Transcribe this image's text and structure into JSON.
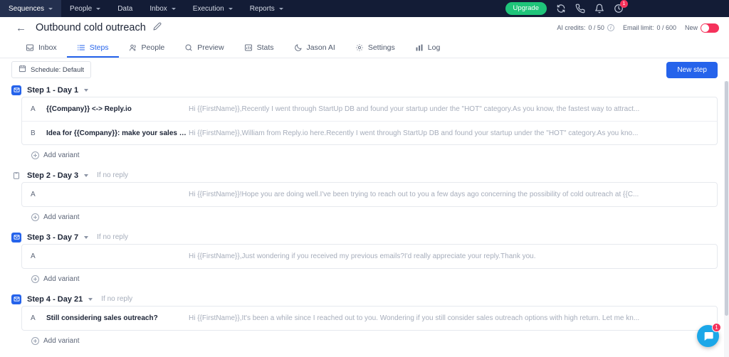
{
  "topnav": {
    "items": [
      {
        "label": "Sequences",
        "caret": true,
        "active": true
      },
      {
        "label": "People",
        "caret": true,
        "active": false
      },
      {
        "label": "Data",
        "caret": false,
        "active": false
      },
      {
        "label": "Inbox",
        "caret": true,
        "active": false
      },
      {
        "label": "Execution",
        "caret": true,
        "active": false
      },
      {
        "label": "Reports",
        "caret": true,
        "active": false
      }
    ],
    "upgrade_label": "Upgrade",
    "icons": [
      {
        "name": "sync-icon",
        "badge": null
      },
      {
        "name": "phone-icon",
        "badge": null
      },
      {
        "name": "bell-icon",
        "badge": null
      },
      {
        "name": "history-icon",
        "badge": "1"
      }
    ],
    "background": "#131c36",
    "upgrade_color": "#1fc47a"
  },
  "header": {
    "back_icon": "back-arrow-icon",
    "title": "Outbound cold outreach",
    "edit_icon": "pencil-icon",
    "ai_credits_label": "AI credits:",
    "ai_credits_value": "0 / 50",
    "email_limit_label": "Email limit:",
    "email_limit_value": "0 / 600",
    "new_label": "New",
    "toggle_on": true,
    "toggle_color": "#f5325b"
  },
  "tabs": [
    {
      "label": "Inbox",
      "icon": "inbox-icon",
      "active": false
    },
    {
      "label": "Steps",
      "icon": "steps-icon",
      "active": true
    },
    {
      "label": "People",
      "icon": "people-icon",
      "active": false
    },
    {
      "label": "Preview",
      "icon": "search-icon",
      "active": false
    },
    {
      "label": "Stats",
      "icon": "stats-icon",
      "active": false
    },
    {
      "label": "Jason AI",
      "icon": "moon-icon",
      "active": false
    },
    {
      "label": "Settings",
      "icon": "gear-icon",
      "active": false
    },
    {
      "label": "Log",
      "icon": "bars-icon",
      "active": false
    }
  ],
  "toolbar": {
    "schedule_label": "Schedule: Default",
    "schedule_icon": "calendar-icon",
    "new_step_label": "New step",
    "new_step_color": "#2563eb"
  },
  "steps": [
    {
      "icon": "email-step-icon",
      "icon_type": "email",
      "label": "Step 1 - Day 1",
      "condition": "",
      "add_variant_label": "Add variant",
      "variants": [
        {
          "letter": "A",
          "subject": "{{Company}} <-> Reply.io",
          "preview": "Hi {{FirstName}},Recently I went through StartUp DB and found your startup under the \"HOT\" category.As you know, the fastest way to attract..."
        },
        {
          "letter": "B",
          "subject": "Idea for {{Company}}: make your sales better!",
          "preview": "Hi {{FirstName}},William from Reply.io here.Recently I went through StartUp DB and found your startup under the \"HOT\" category.As you kno..."
        }
      ]
    },
    {
      "icon": "task-step-icon",
      "icon_type": "task",
      "label": "Step 2 - Day 3",
      "condition": "If no reply",
      "add_variant_label": "Add variant",
      "variants": [
        {
          "letter": "A",
          "subject": "",
          "preview": "Hi {{FirstName}}!Hope you are doing well.I've been trying to reach out to you a few days ago concerning the possibility of cold outreach at {{C..."
        }
      ]
    },
    {
      "icon": "email-step-icon",
      "icon_type": "email",
      "label": "Step 3 - Day 7",
      "condition": "If no reply",
      "add_variant_label": "Add variant",
      "variants": [
        {
          "letter": "A",
          "subject": "",
          "preview": "Hi {{FirstName}},Just wondering if you received my previous emails?I'd really appreciate your reply.Thank you."
        }
      ]
    },
    {
      "icon": "email-step-icon",
      "icon_type": "email",
      "label": "Step 4 - Day 21",
      "condition": "If no reply",
      "add_variant_label": "Add variant",
      "variants": [
        {
          "letter": "A",
          "subject": "Still considering sales outreach?",
          "preview": "Hi {{FirstName}},It's been a while since I reached out to you. Wondering if you still consider sales outreach options with high return. Let me kn..."
        }
      ]
    }
  ],
  "chat": {
    "icon": "chat-bubble-icon",
    "badge": "1",
    "color": "#1ba7e8"
  }
}
